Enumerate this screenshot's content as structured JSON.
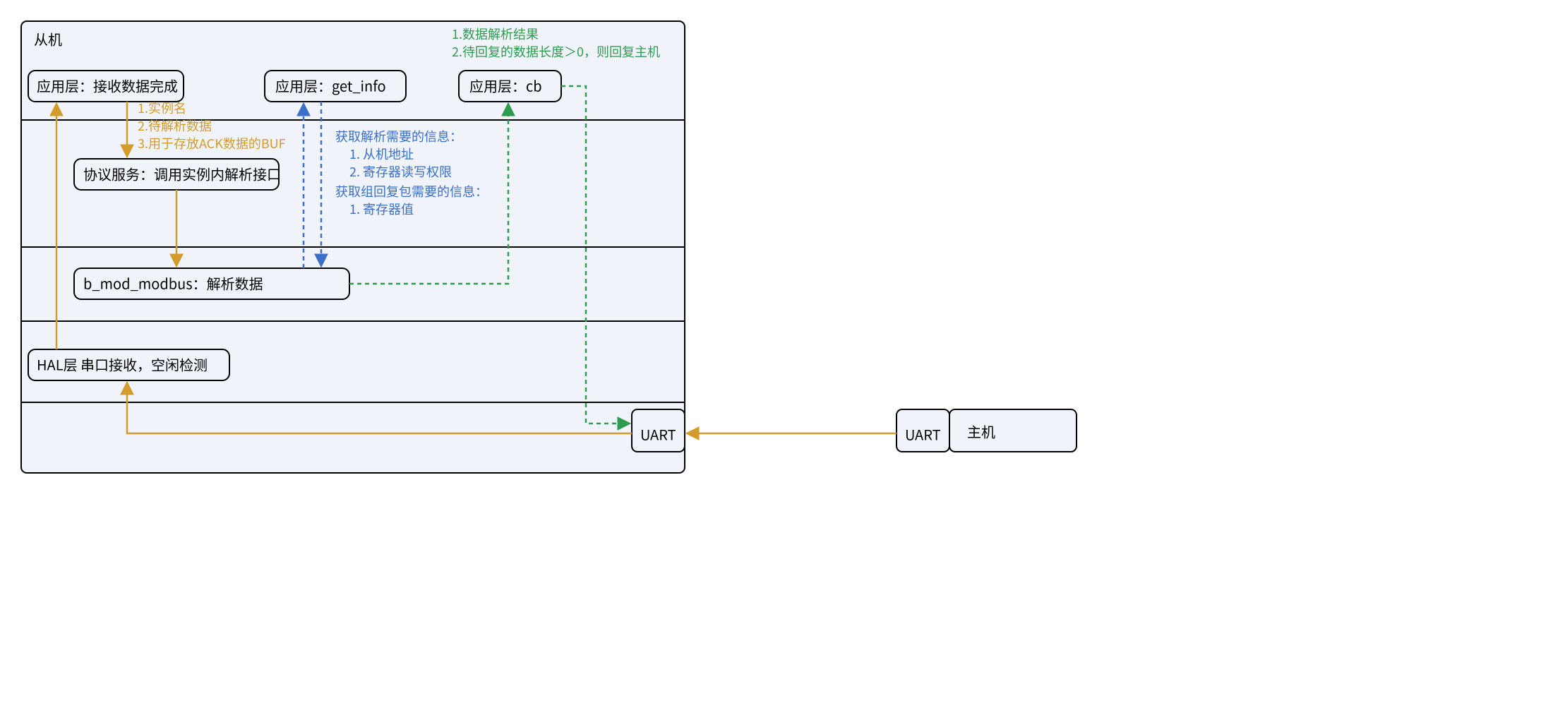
{
  "container": {
    "title": "从机"
  },
  "nodes": {
    "app_recv": {
      "label": "应用层：接收数据完成"
    },
    "app_get": {
      "label": "应用层：get_info"
    },
    "app_cb": {
      "label": "应用层：cb"
    },
    "proto": {
      "label": "协议服务：调用实例内解析接口"
    },
    "modbus": {
      "label": "b_mod_modbus：解析数据"
    },
    "hal": {
      "label": "HAL层 串口接收，空闲检测"
    },
    "uart_s": {
      "label": "UART"
    },
    "uart_h": {
      "label": "UART"
    },
    "host": {
      "label": "主机"
    }
  },
  "annot": {
    "orange": {
      "l1": "1.实例名",
      "l2": "2.待解析数据",
      "l3": "3.用于存放ACK数据的BUF"
    },
    "blue": {
      "t": "获取解析需要的信息：",
      "a1": "1. 从机地址",
      "a2": "2. 寄存器读写权限",
      "t2": "获取组回复包需要的信息：",
      "b1": "1. 寄存器值"
    },
    "green": {
      "l1": "1.数据解析结果",
      "l2": "2.待回复的数据长度＞0，则回复主机"
    }
  }
}
